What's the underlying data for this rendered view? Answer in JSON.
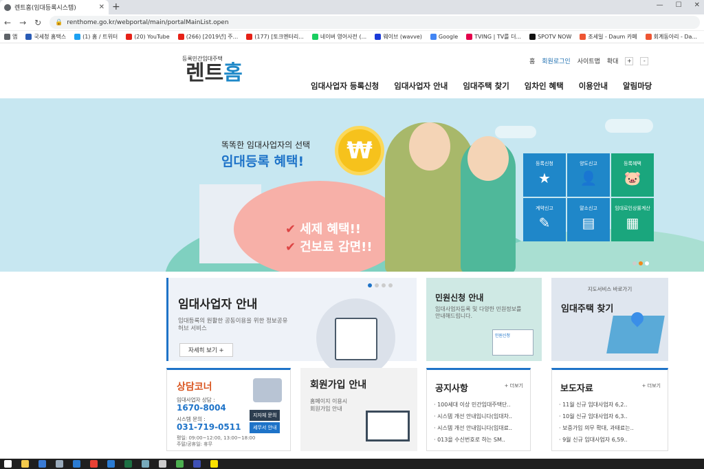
{
  "browser": {
    "tab_title": "렌트홈(임대등록시스템)",
    "url": "renthome.go.kr/webportal/main/portalMainList.open",
    "bookmarks": [
      {
        "label": "앱",
        "color": "#5f6368"
      },
      {
        "label": "국세청 홈택스",
        "color": "#2a5bb5"
      },
      {
        "label": "(1) 홈 / 트위터",
        "color": "#1da1f2"
      },
      {
        "label": "(20) YouTube",
        "color": "#e62117"
      },
      {
        "label": "(266) [2019년] 주...",
        "color": "#e62117"
      },
      {
        "label": "(177) [토크멘터리...",
        "color": "#e62117"
      },
      {
        "label": "네이버 영어사전 (...",
        "color": "#19ce60"
      },
      {
        "label": "웨이브 (wavve)",
        "color": "#1a3ad8"
      },
      {
        "label": "Google",
        "color": "#4285f4"
      },
      {
        "label": "TVING | TV를 더...",
        "color": "#e4004b"
      },
      {
        "label": "SPOTV NOW",
        "color": "#111"
      },
      {
        "label": "조세일 - Daum 카페",
        "color": "#e53"
      },
      {
        "label": "회계동아리 - Da...",
        "color": "#e53"
      }
    ]
  },
  "header": {
    "logo_sub": "등록민간임대주택",
    "logo_a": "렌트",
    "logo_b": "홈",
    "util": [
      "홈",
      "회원로그인",
      "사이트맵",
      "확대"
    ],
    "zoom_plus": "+",
    "zoom_minus": "-",
    "nav": [
      "임대사업자 등록신청",
      "임대사업자 안내",
      "임대주택 찾기",
      "임차인 혜택",
      "이용안내",
      "알림마당"
    ]
  },
  "hero": {
    "small": "똑똑한 임대사업자의 선택",
    "big": "임대등록 혜택!",
    "coin": "₩",
    "c1": "세제 혜택!!",
    "c2": "건보료 감면!!",
    "quick": [
      {
        "label": "등록신청",
        "icon": "★",
        "tone": "blue"
      },
      {
        "label": "양도신고",
        "icon": "👤",
        "tone": "blue"
      },
      {
        "label": "등록혜택",
        "icon": "🐷",
        "tone": "green"
      },
      {
        "label": "계약신고",
        "icon": "✎",
        "tone": "blue"
      },
      {
        "label": "말소신고",
        "icon": "▤",
        "tone": "blue"
      },
      {
        "label": "임대료인상률계산",
        "icon": "▦",
        "tone": "green"
      }
    ]
  },
  "boxes": {
    "guide": {
      "title": "임대사업자 안내",
      "desc": "임대등록의 원활한 공동이용을 위한 정보공유 허브 서비스",
      "more": "자세히 보기 +"
    },
    "petition": {
      "title": "민원신청 안내",
      "desc": "임대사업자등록 및 다양한 민원정보를 안내해드립니다.",
      "card": "민원신청"
    },
    "find": {
      "sub": "지도서비스 바로가기",
      "title": "임대주택 찾기"
    },
    "counsel": {
      "title": "상담코너",
      "l1": "임대사업자 상담 :",
      "n1": "1670-8004",
      "l2": "시스템 문의 :",
      "n2": "031-719-0511",
      "h1": "평일: 09:00~12:00, 13:00~18:00",
      "h2": "주말/공휴일: 휴무",
      "btn1": "지자체 문의",
      "btn2": "세무서 안내"
    },
    "join": {
      "title": "회원가입 안내",
      "desc1": "홈페이지 이용시",
      "desc2": "회원가입 안내"
    },
    "notice": {
      "title": "공지사항",
      "more": "+ 더보기",
      "items": [
        "100세대 이상 민간임대주택단..",
        "시스템 개선 안내입니다(임대차..",
        "시스템 개선 안내입니다(임대료..",
        "013을 수신번호로 하는 SM.."
      ]
    },
    "press": {
      "title": "보도자료",
      "more": "+ 더보기",
      "items": [
        "11월 신규 임대사업자 6,2..",
        "10월 신규 임대사업자 6,3..",
        "보증가입 의무 확대, 과태료는..",
        "9월 신규 임대사업자 6,59.."
      ]
    }
  }
}
